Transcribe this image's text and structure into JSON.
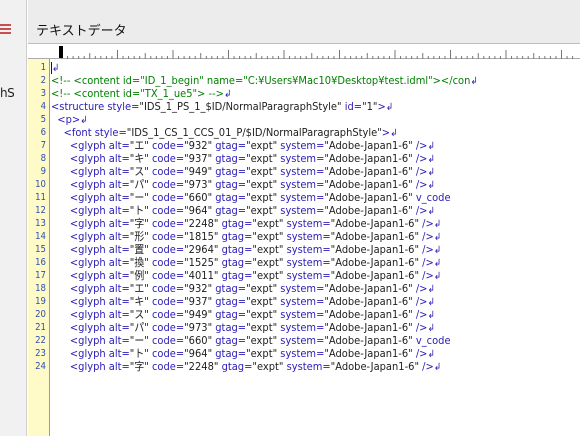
{
  "panel": {
    "title": "テキストデータ",
    "left_fragment": "hS"
  },
  "colors": {
    "gutter_bg": "#fffbc9",
    "line_number": "#2d4fb0",
    "tag_text": "#2a1cb4",
    "comment_text": "#008000"
  },
  "line_numbers": [
    "1",
    "2",
    "3",
    "4",
    "5",
    "6",
    "7",
    "8",
    "9",
    "10",
    "11",
    "12",
    "13",
    "14",
    "15",
    "16",
    "17",
    "18",
    "19",
    "20",
    "21",
    "22",
    "23",
    "24"
  ],
  "lines": [
    {
      "text": "",
      "kind": "cursor"
    },
    {
      "text": "<!-- <content id=\"ID_1_begin\" name=\"C:¥Users¥Mac10¥Desktop¥test.idml\"></con",
      "kind": "comment"
    },
    {
      "text": "<!-- <content id=\"TX_1_ue5\"> -->",
      "kind": "comment"
    },
    {
      "text": "<structure style=\"IDS_1_PS_1_$ID/NormalParagraphStyle\" id=\"1\">",
      "kind": "tag"
    },
    {
      "text": "  <p>",
      "kind": "tag"
    },
    {
      "text": "    <font style=\"IDS_1_CS_1_CCS_01_P/$ID/NormalParagraphStyle\">",
      "kind": "tag"
    },
    {
      "text": "      <glyph alt=\"エ\" code=\"932\" gtag=\"expt\" system=\"Adobe-Japan1-6\" />",
      "kind": "glyph"
    },
    {
      "text": "      <glyph alt=\"キ\" code=\"937\" gtag=\"expt\" system=\"Adobe-Japan1-6\" />",
      "kind": "glyph"
    },
    {
      "text": "      <glyph alt=\"ス\" code=\"949\" gtag=\"expt\" system=\"Adobe-Japan1-6\" />",
      "kind": "glyph"
    },
    {
      "text": "      <glyph alt=\"パ\" code=\"973\" gtag=\"expt\" system=\"Adobe-Japan1-6\" />",
      "kind": "glyph"
    },
    {
      "text": "      <glyph alt=\"ー\" code=\"660\" gtag=\"expt\" system=\"Adobe-Japan1-6\" v_code",
      "kind": "glyph_cut"
    },
    {
      "text": "      <glyph alt=\"ト\" code=\"964\" gtag=\"expt\" system=\"Adobe-Japan1-6\" />",
      "kind": "glyph"
    },
    {
      "text": "      <glyph alt=\"字\" code=\"2248\" gtag=\"expt\" system=\"Adobe-Japan1-6\" />",
      "kind": "glyph"
    },
    {
      "text": "      <glyph alt=\"形\" code=\"1815\" gtag=\"expt\" system=\"Adobe-Japan1-6\" />",
      "kind": "glyph"
    },
    {
      "text": "      <glyph alt=\"置\" code=\"2964\" gtag=\"expt\" system=\"Adobe-Japan1-6\" />",
      "kind": "glyph"
    },
    {
      "text": "      <glyph alt=\"換\" code=\"1525\" gtag=\"expt\" system=\"Adobe-Japan1-6\" />",
      "kind": "glyph"
    },
    {
      "text": "      <glyph alt=\"例\" code=\"4011\" gtag=\"expt\" system=\"Adobe-Japan1-6\" />",
      "kind": "glyph"
    },
    {
      "text": "      <glyph alt=\"エ\" code=\"932\" gtag=\"expt\" system=\"Adobe-Japan1-6\" />",
      "kind": "glyph"
    },
    {
      "text": "      <glyph alt=\"キ\" code=\"937\" gtag=\"expt\" system=\"Adobe-Japan1-6\" />",
      "kind": "glyph"
    },
    {
      "text": "      <glyph alt=\"ス\" code=\"949\" gtag=\"expt\" system=\"Adobe-Japan1-6\" />",
      "kind": "glyph"
    },
    {
      "text": "      <glyph alt=\"パ\" code=\"973\" gtag=\"expt\" system=\"Adobe-Japan1-6\" />",
      "kind": "glyph"
    },
    {
      "text": "      <glyph alt=\"ー\" code=\"660\" gtag=\"expt\" system=\"Adobe-Japan1-6\" v_code",
      "kind": "glyph_cut"
    },
    {
      "text": "      <glyph alt=\"ト\" code=\"964\" gtag=\"expt\" system=\"Adobe-Japan1-6\" />",
      "kind": "glyph"
    },
    {
      "text": "      <glyph alt=\"字\" code=\"2248\" gtag=\"expt\" system=\"Adobe-Japan1-6\" />",
      "kind": "glyph"
    }
  ]
}
